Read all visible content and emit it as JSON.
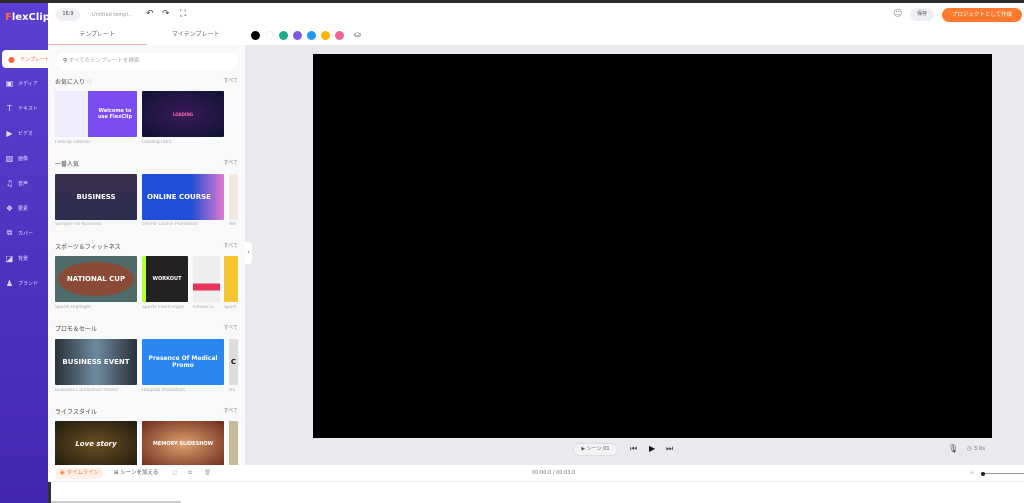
{
  "app": {
    "logo": "FlexClip"
  },
  "header": {
    "ratio": "16:9",
    "title": "Untitled templ...",
    "save": "保存",
    "create": "プロジェクトとして作成"
  },
  "sidebar": {
    "items": [
      {
        "label": "テンプレート",
        "icon": "template-icon"
      },
      {
        "label": "メディア",
        "icon": "media-icon"
      },
      {
        "label": "テキスト",
        "icon": "text-icon"
      },
      {
        "label": "ビデオ",
        "icon": "video-icon"
      },
      {
        "label": "画像",
        "icon": "image-icon"
      },
      {
        "label": "音声",
        "icon": "music-icon"
      },
      {
        "label": "要素",
        "icon": "elements-icon"
      },
      {
        "label": "カバー",
        "icon": "cover-icon"
      },
      {
        "label": "背景",
        "icon": "background-icon"
      },
      {
        "label": "ブランド",
        "icon": "brand-icon"
      }
    ]
  },
  "panel": {
    "tabs": [
      "テンプレート",
      "マイテンプレート"
    ],
    "search_placeholder": "すべてのテンプレートを検索",
    "see_all": "すべて",
    "sections": [
      {
        "title": "お気に入り",
        "items": [
          {
            "thumb": "Welcome to use FlexClip",
            "caption": "Flexclip Tutorial"
          },
          {
            "thumb": "LOADING",
            "caption": "Loading Intro"
          }
        ]
      },
      {
        "title": "一番人気",
        "items": [
          {
            "thumb": "BUSINESS",
            "caption": "Sample For Business"
          },
          {
            "thumb": "ONLINE COURSE",
            "caption": "Online Course Promotion"
          },
          {
            "thumb": "",
            "caption": "We"
          }
        ]
      },
      {
        "title": "スポーツ＆フィットネス",
        "items": [
          {
            "thumb": "NATIONAL CUP",
            "caption": "Sports Highlight"
          },
          {
            "thumb": "WORKOUT",
            "caption": "Sports Event Hype"
          },
          {
            "thumb": "",
            "caption": "Fitness S..."
          },
          {
            "thumb": "",
            "caption": "Sport"
          }
        ]
      },
      {
        "title": "プロモ＆セール",
        "items": [
          {
            "thumb": "BUSINESS EVENT",
            "caption": "Business Conference Promo"
          },
          {
            "thumb": "Presence Of Medical Promo",
            "caption": "Hospital Promotion"
          },
          {
            "thumb": "C",
            "caption": "He"
          }
        ]
      },
      {
        "title": "ライフスタイル",
        "items": [
          {
            "thumb": "Love story",
            "caption": ""
          },
          {
            "thumb": "MEMORY SLIDESHOW",
            "caption": ""
          }
        ]
      }
    ]
  },
  "colors": [
    "#000000",
    "#ffffff",
    "#1aaa8a",
    "#7b5ce0",
    "#2196f3",
    "#ffb300",
    "#f06292"
  ],
  "player": {
    "scene": "▶ シーン 01",
    "duration": "3.0s"
  },
  "timeline": {
    "tab": "タイムライン",
    "add_scene": "シーンを加える",
    "time": "00:00.0 / 00:03.0"
  }
}
